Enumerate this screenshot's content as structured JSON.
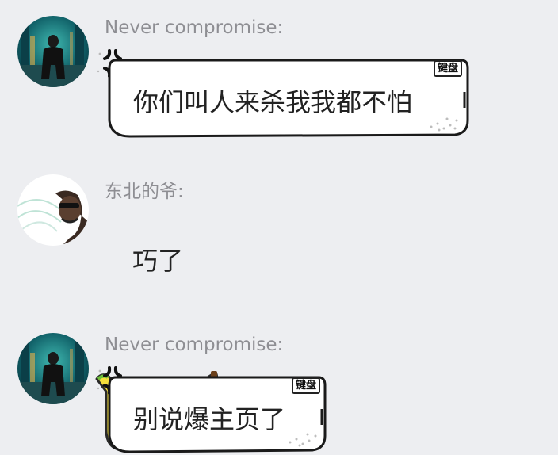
{
  "messages": [
    {
      "sender": "Never compromise:",
      "text": "你们叫人来杀我我都不怕",
      "badge": "键盘",
      "avatar_icon": "city-night-figure-icon"
    },
    {
      "sender": "东北的爷:",
      "text": "巧了",
      "avatar_icon": "man-with-sunglasses-icon"
    },
    {
      "sender": "Never compromise:",
      "text": "别说爆主页了",
      "badge": "键盘",
      "avatar_icon": "city-night-figure-icon"
    }
  ],
  "colors": {
    "background": "#edeef1",
    "banana_yellow": "#f5de3b",
    "comic_bubble": "#ffffff"
  }
}
